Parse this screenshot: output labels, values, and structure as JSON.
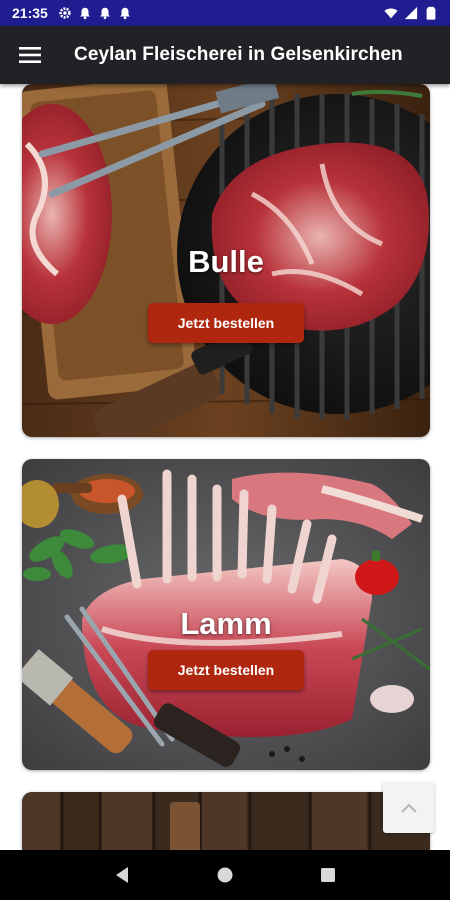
{
  "status_bar": {
    "time": "21:35",
    "left_icons": [
      "gear-icon",
      "bell-icon",
      "bell-icon",
      "bell-icon"
    ],
    "right_icons": [
      "wifi-icon",
      "signal-icon",
      "battery-icon"
    ]
  },
  "app_bar": {
    "title": "Ceylan Fleischerei in Gelsenkirchen",
    "menu_icon": "hamburger-menu-icon"
  },
  "cards": [
    {
      "title": "Bulle",
      "button_label": "Jetzt bestellen"
    },
    {
      "title": "Lamm",
      "button_label": "Jetzt bestellen"
    }
  ],
  "scroll_top_icon": "chevron-up-icon",
  "colors": {
    "status_bar": "#1f1d8f",
    "app_bar": "#222226",
    "button": "#b0270f"
  }
}
